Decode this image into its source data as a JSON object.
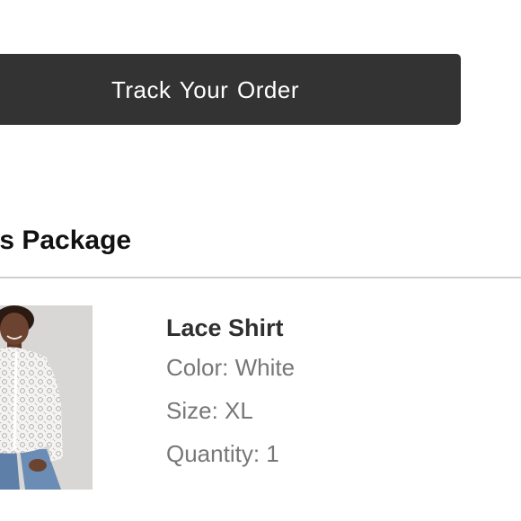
{
  "track_order": {
    "button_label": "Track Your Order"
  },
  "package": {
    "heading": "is Package"
  },
  "product": {
    "name": "Lace Shirt",
    "color": "Color: White",
    "size": "Size: XL",
    "quantity": "Quantity: 1",
    "image_icon": "product-photo"
  },
  "colors": {
    "button_bg": "#333333",
    "button_text": "#ffffff",
    "divider": "#cfcfcf",
    "attribute_text": "#777777",
    "name_text": "#2f2f2f"
  }
}
